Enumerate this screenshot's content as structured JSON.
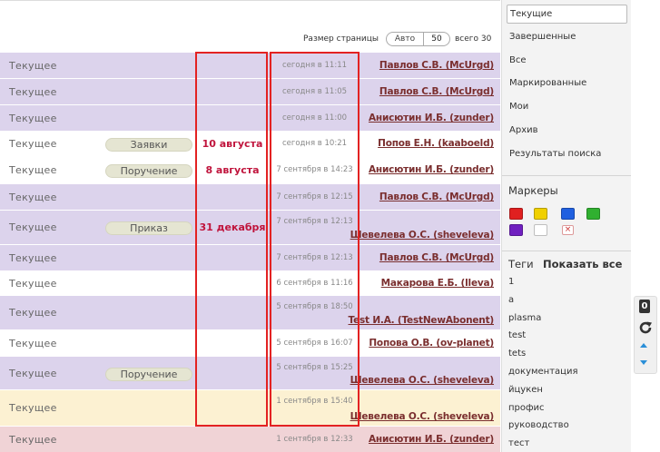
{
  "pager": {
    "label": "Размер страницы",
    "auto": "Авто",
    "value": "50",
    "total": "всего 30"
  },
  "rows": [
    {
      "status": "Текущее",
      "tag": "",
      "deadline": "",
      "date": "сегодня в 11:11",
      "person": "Павлов С.В. (McUrgd)",
      "color": "purple"
    },
    {
      "status": "Текущее",
      "tag": "",
      "deadline": "",
      "date": "сегодня в 11:05",
      "person": "Павлов С.В. (McUrgd)",
      "color": "purple"
    },
    {
      "status": "Текущее",
      "tag": "",
      "deadline": "",
      "date": "сегодня в 11:00",
      "person": "Анисютин И.Б. (zunder)",
      "color": "purple"
    },
    {
      "status": "Текущее",
      "tag": "Заявки",
      "deadline": "10 августа",
      "date": "сегодня в 10:21",
      "person": "Попов Е.Н. (kaaboeld)",
      "color": "white"
    },
    {
      "status": "Текущее",
      "tag": "Поручение",
      "deadline": "8 августа",
      "date": "7 сентября в 14:23",
      "person": "Анисютин И.Б. (zunder)",
      "color": "white"
    },
    {
      "status": "Текущее",
      "tag": "",
      "deadline": "",
      "date": "7 сентября в 12:15",
      "person": "Павлов С.В. (McUrgd)",
      "color": "purple"
    },
    {
      "status": "Текущее",
      "tag": "Приказ",
      "deadline": "31 декабря",
      "date": "7 сентября в 12:13",
      "person": "Шевелева О.С. (sheveleva)",
      "color": "purple"
    },
    {
      "status": "Текущее",
      "tag": "",
      "deadline": "",
      "date": "7 сентября в 12:13",
      "person": "Павлов С.В. (McUrgd)",
      "color": "purple"
    },
    {
      "status": "Текущее",
      "tag": "",
      "deadline": "",
      "date": "6 сентября в 11:16",
      "person": "Макарова Е.Б. (lleva)",
      "color": "white"
    },
    {
      "status": "Текущее",
      "tag": "",
      "deadline": "",
      "date": "5 сентября в 18:50",
      "person": "Test И.А. (TestNewAbonent)",
      "color": "purple"
    },
    {
      "status": "Текущее",
      "tag": "",
      "deadline": "",
      "date": "5 сентября в 16:07",
      "person": "Попова О.В. (ov-planet)",
      "color": "white"
    },
    {
      "status": "Текущее",
      "tag": "Поручение",
      "deadline": "",
      "date": "5 сентября в 15:25",
      "person": "Шевелева О.С. (sheveleva)",
      "color": "purple"
    },
    {
      "status": "Текущее",
      "tag": "",
      "deadline": "",
      "date": "1 сентября в 15:40",
      "person": "Шевелева О.С. (sheveleva)",
      "color": "yellow"
    },
    {
      "status": "Текущее",
      "tag": "",
      "deadline": "",
      "date": "1 сентября в 12:33",
      "person": "Анисютин И.Б. (zunder)",
      "color": "pink"
    }
  ],
  "sidebar": {
    "filters": [
      "Текущие",
      "Завершенные",
      "Все",
      "Маркированные",
      "Мои",
      "Архив",
      "Результаты поиска"
    ],
    "markers_title": "Маркеры",
    "marker_colors": [
      "#e02020",
      "#f0d000",
      "#2060e0",
      "#30b030",
      "#7020c0",
      "#ffffff"
    ],
    "marker_clear": "×",
    "tags_title": "Теги",
    "show_all": "Показать все",
    "tags": [
      "1",
      "a",
      "plasma",
      "test",
      "tets",
      "документация",
      "йцукен",
      "профис",
      "руководство",
      "тест"
    ]
  },
  "toolbar": {
    "count": "0"
  }
}
